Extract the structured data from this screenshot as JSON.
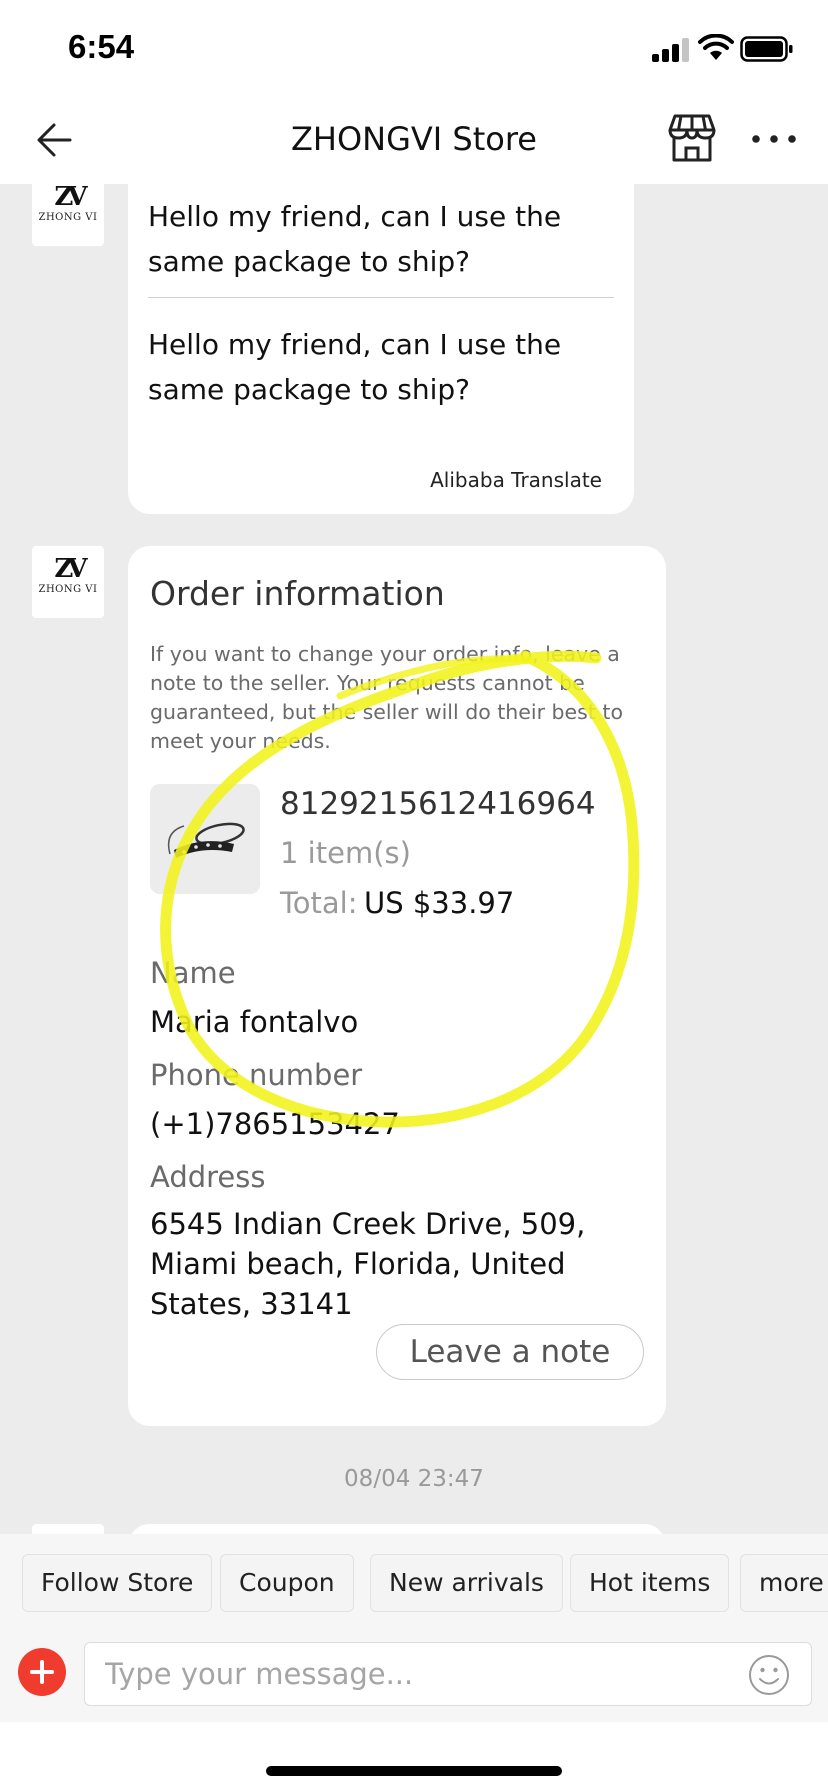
{
  "status_bar": {
    "time": "6:54"
  },
  "nav": {
    "title": "ZHONGVI Store",
    "back_icon": "back-arrow-icon",
    "store_icon": "storefront-icon",
    "more_icon": "more-dots-icon"
  },
  "store_avatar": {
    "monogram": "ZV",
    "caption": "ZHONG VI"
  },
  "messages": [
    {
      "original": "Hello my friend, can I use the same package to ship?",
      "translated": "Hello my friend, can I use the same package to ship?",
      "translation_note": "Alibaba Translate"
    }
  ],
  "order_card": {
    "title": "Order information",
    "description": "If you want to change your order info, leave a note to the seller. Your requests cannot be guaranteed, but the seller will do their best to meet your needs.",
    "order_number": "8129215612416964",
    "item_count": "1 item(s)",
    "total_label": "Total:",
    "total_value": "US $33.97",
    "name_label": "Name",
    "name_value": "Maria fontalvo",
    "phone_label": "Phone number",
    "phone_value": "(+1)7865153427",
    "address_label": "Address",
    "address_value": "6545 Indian Creek Drive, 509, Miami beach, Florida, United States, 33141",
    "leave_note_label": "Leave a note"
  },
  "timestamp": "08/04 23:47",
  "quick_replies": [
    "Follow Store",
    "Coupon",
    "New arrivals",
    "Hot items",
    "more p"
  ],
  "composer": {
    "placeholder": "Type your message...",
    "add_icon": "plus-circle-icon",
    "emoji_icon": "smiley-icon"
  },
  "colors": {
    "accent_red": "#f03c2f",
    "highlight_yellow": "#f2f21a",
    "background": "#ececec"
  }
}
